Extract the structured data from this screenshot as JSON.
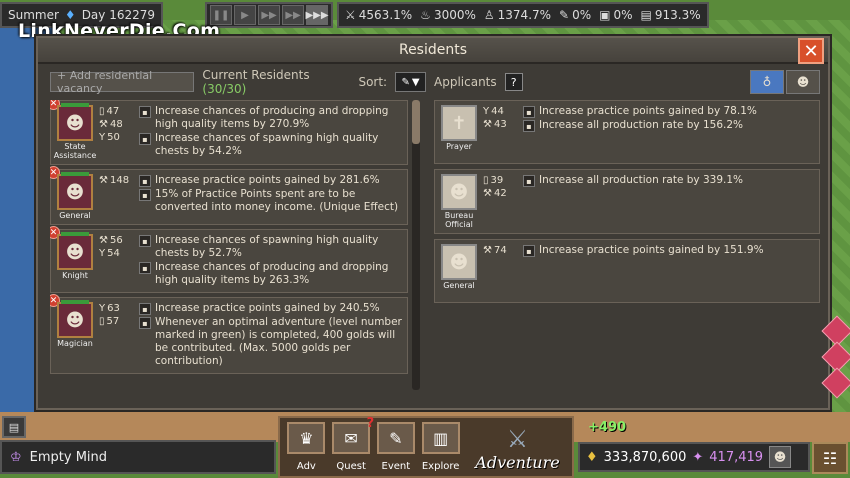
{
  "watermark": "LinkNeverDie.Com",
  "topbar": {
    "season": "Summer",
    "day": "Day 162279",
    "speed_buttons": [
      "pause",
      "play",
      "fast",
      "faster",
      "fastest"
    ],
    "stats": [
      {
        "icon": "sword-icon",
        "glyph": "⚔",
        "value": "4563.1%"
      },
      {
        "icon": "lamp-icon",
        "glyph": "♨",
        "value": "3000%"
      },
      {
        "icon": "practice-icon",
        "glyph": "♙",
        "value": "1374.7%"
      },
      {
        "icon": "quill-icon",
        "glyph": "✎",
        "value": "0%"
      },
      {
        "icon": "chest-icon",
        "glyph": "▣",
        "value": "0%"
      },
      {
        "icon": "book-icon",
        "glyph": "▤",
        "value": "913.3%"
      }
    ]
  },
  "dialog": {
    "title": "Residents",
    "close": "✕",
    "add_vacancy": "+ Add residential vacancy",
    "current_residents_label": "Current Residents",
    "current_residents_count": "(30/30)",
    "sort_label": "Sort:",
    "applicants_label": "Applicants",
    "help": "?",
    "tabs": [
      "money-bag",
      "resident"
    ]
  },
  "residents": [
    {
      "name": "State Assistance",
      "glyph": "☻",
      "stats": [
        {
          "icon": "▯",
          "value": "47"
        },
        {
          "icon": "⚒",
          "value": "48"
        },
        {
          "icon": "Y",
          "value": "50"
        }
      ],
      "effects": [
        "Increase chances of producing and dropping high quality items by 270.9%",
        "Increase chances of spawning high quality chests by 54.2%"
      ]
    },
    {
      "name": "General",
      "glyph": "☻",
      "stats": [
        {
          "icon": "⚒",
          "value": "148"
        }
      ],
      "effects": [
        "Increase practice points gained by 281.6%",
        "15% of Practice Points spent are to be converted into money income. (Unique Effect)"
      ]
    },
    {
      "name": "Knight",
      "glyph": "☻",
      "stats": [
        {
          "icon": "⚒",
          "value": "56"
        },
        {
          "icon": "Y",
          "value": "54"
        }
      ],
      "effects": [
        "Increase chances of spawning high quality chests by 52.7%",
        "Increase chances of producing and dropping high quality items by 263.3%"
      ]
    },
    {
      "name": "Magician",
      "glyph": "☻",
      "stats": [
        {
          "icon": "Y",
          "value": "63"
        },
        {
          "icon": "▯",
          "value": "57"
        }
      ],
      "effects": [
        "Increase practice points gained by 240.5%",
        "Whenever an optimal adventure (level number marked in green) is completed, 400 golds will be contributed. (Max. 5000 golds per contribution)"
      ]
    }
  ],
  "applicants": [
    {
      "name": "Prayer",
      "glyph": "✝",
      "stats": [
        {
          "icon": "Y",
          "value": "44"
        },
        {
          "icon": "⚒",
          "value": "43"
        }
      ],
      "effects": [
        "Increase practice points gained by 78.1%",
        "Increase all production rate by 156.2%"
      ]
    },
    {
      "name": "Bureau Official",
      "glyph": "☻",
      "stats": [
        {
          "icon": "▯",
          "value": "39"
        },
        {
          "icon": "⚒",
          "value": "42"
        }
      ],
      "effects": [
        "Increase all production rate by 339.1%"
      ]
    },
    {
      "name": "General",
      "glyph": "☻",
      "stats": [
        {
          "icon": "⚒",
          "value": "74"
        }
      ],
      "effects": [
        "Increase practice points gained by 151.9%"
      ]
    }
  ],
  "bottom": {
    "mind": "Empty Mind",
    "nav": [
      {
        "label": "Adv",
        "glyph": "♛"
      },
      {
        "label": "Quest",
        "glyph": "✉"
      },
      {
        "label": "Event",
        "glyph": "✎"
      },
      {
        "label": "Explore",
        "glyph": "▥"
      }
    ],
    "quest_badge": "?",
    "adventure": "Adventure",
    "gain": "+490",
    "gold": "333,870,600",
    "gems": "417,419"
  },
  "colors": {
    "accent_close": "#d8502a",
    "gain": "#88ee66",
    "gem": "#d890f0"
  }
}
